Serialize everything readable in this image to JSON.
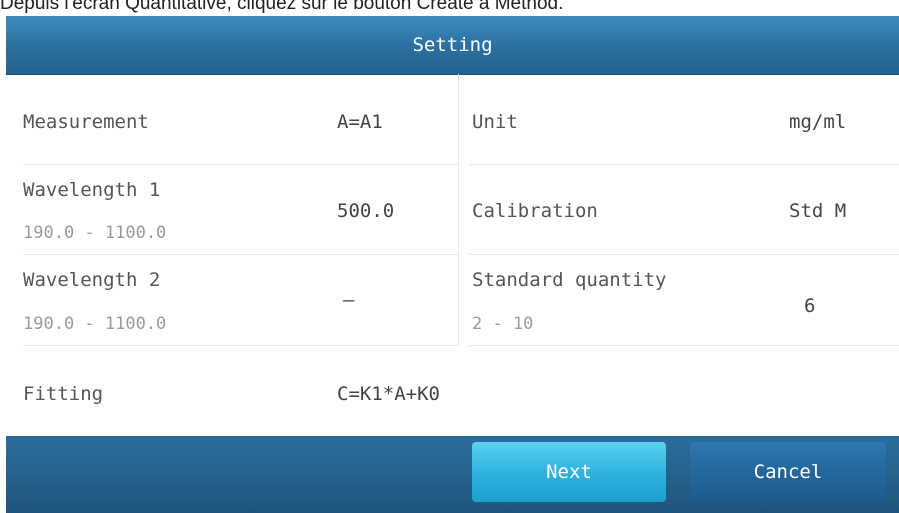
{
  "caption": "Depuis l'écran Quantitative, cliquez sur le bouton Create a Method.",
  "dialog": {
    "title": "Setting",
    "measurement": {
      "label": "Measurement",
      "value": "A=A1"
    },
    "unit": {
      "label": "Unit",
      "value": "mg/ml"
    },
    "wavelength1": {
      "label": "Wavelength 1",
      "range": "190.0 - 1100.0",
      "value": "500.0"
    },
    "calibration": {
      "label": "Calibration",
      "value": "Std M"
    },
    "wavelength2": {
      "label": "Wavelength 2",
      "range": "190.0 - 1100.0",
      "value": "—"
    },
    "standard_quantity": {
      "label": "Standard quantity",
      "range": "2 - 10",
      "value": "6"
    },
    "fitting": {
      "label": "Fitting",
      "value": "C=K1*A+K0"
    },
    "buttons": {
      "next": "Next",
      "cancel": "Cancel"
    }
  }
}
